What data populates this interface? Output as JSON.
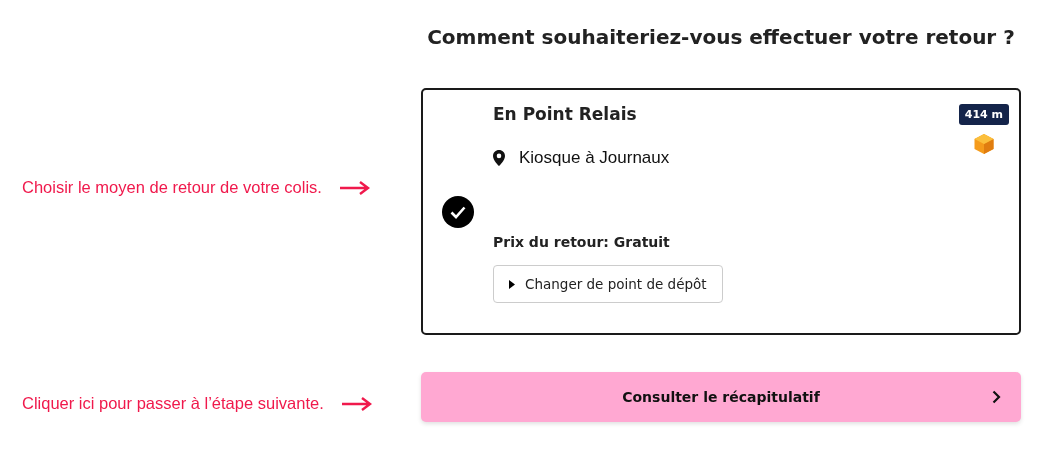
{
  "heading": "Comment souhaiteriez-vous effectuer votre retour ?",
  "annotations": [
    {
      "text": "Choisir le moyen de retour de votre colis."
    },
    {
      "text": "Cliquer ici pour passer à l’étape suivante."
    }
  ],
  "option": {
    "title": "En Point Relais",
    "location": "Kiosque à Journaux",
    "distance": "414 m",
    "price": "Prix du retour: Gratuit",
    "change_button": "Changer de point de dépôt",
    "selected": true
  },
  "next_button": "Consulter le récapitulatif"
}
